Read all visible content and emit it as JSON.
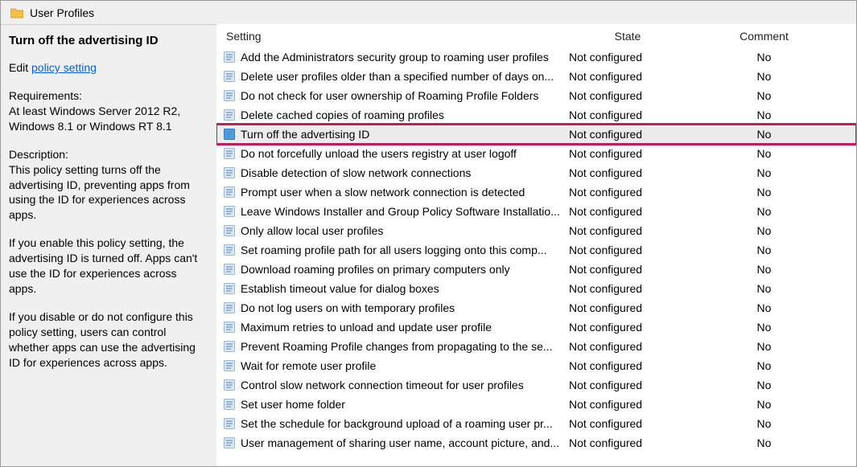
{
  "header": {
    "title": "User Profiles"
  },
  "left": {
    "selected_title": "Turn off the advertising ID",
    "edit_prefix": "Edit ",
    "edit_link": "policy setting ",
    "requirements_label": "Requirements:",
    "requirements_body": "At least Windows Server 2012 R2, Windows 8.1 or Windows RT 8.1",
    "description_label": "Description:",
    "description_p1": "This policy setting turns off the advertising ID, preventing apps from using the ID for experiences across apps.",
    "description_p2": "If you enable this policy setting, the advertising ID is turned off. Apps can't use the ID for experiences across apps.",
    "description_p3": "If you disable or do not configure this policy setting, users can control whether apps can use the advertising ID for experiences across apps."
  },
  "columns": {
    "setting": "Setting",
    "state": "State",
    "comment": "Comment"
  },
  "rows": [
    {
      "name": "Add the Administrators security group to roaming user profiles",
      "state": "Not configured",
      "comment": "No"
    },
    {
      "name": "Delete user profiles older than a specified number of days on...",
      "state": "Not configured",
      "comment": "No"
    },
    {
      "name": "Do not check for user ownership of Roaming Profile Folders",
      "state": "Not configured",
      "comment": "No"
    },
    {
      "name": "Delete cached copies of roaming profiles",
      "state": "Not configured",
      "comment": "No"
    },
    {
      "name": "Turn off the advertising ID",
      "state": "Not configured",
      "comment": "No",
      "selected": true,
      "highlighted": true
    },
    {
      "name": "Do not forcefully unload the users registry at user logoff",
      "state": "Not configured",
      "comment": "No"
    },
    {
      "name": "Disable detection of slow network connections",
      "state": "Not configured",
      "comment": "No"
    },
    {
      "name": "Prompt user when a slow network connection is detected",
      "state": "Not configured",
      "comment": "No"
    },
    {
      "name": "Leave Windows Installer and Group Policy Software Installatio...",
      "state": "Not configured",
      "comment": "No"
    },
    {
      "name": "Only allow local user profiles",
      "state": "Not configured",
      "comment": "No"
    },
    {
      "name": "Set roaming profile path for all users logging onto this comp...",
      "state": "Not configured",
      "comment": "No"
    },
    {
      "name": "Download roaming profiles on primary computers only",
      "state": "Not configured",
      "comment": "No"
    },
    {
      "name": "Establish timeout value for dialog boxes",
      "state": "Not configured",
      "comment": "No"
    },
    {
      "name": "Do not log users on with temporary profiles",
      "state": "Not configured",
      "comment": "No"
    },
    {
      "name": "Maximum retries to unload and update user profile",
      "state": "Not configured",
      "comment": "No"
    },
    {
      "name": "Prevent Roaming Profile changes from propagating to the se...",
      "state": "Not configured",
      "comment": "No"
    },
    {
      "name": "Wait for remote user profile",
      "state": "Not configured",
      "comment": "No"
    },
    {
      "name": "Control slow network connection timeout for user profiles",
      "state": "Not configured",
      "comment": "No"
    },
    {
      "name": "Set user home folder",
      "state": "Not configured",
      "comment": "No"
    },
    {
      "name": "Set the schedule for background upload of a roaming user pr...",
      "state": "Not configured",
      "comment": "No"
    },
    {
      "name": "User management of sharing user name, account picture, and...",
      "state": "Not configured",
      "comment": "No"
    }
  ]
}
